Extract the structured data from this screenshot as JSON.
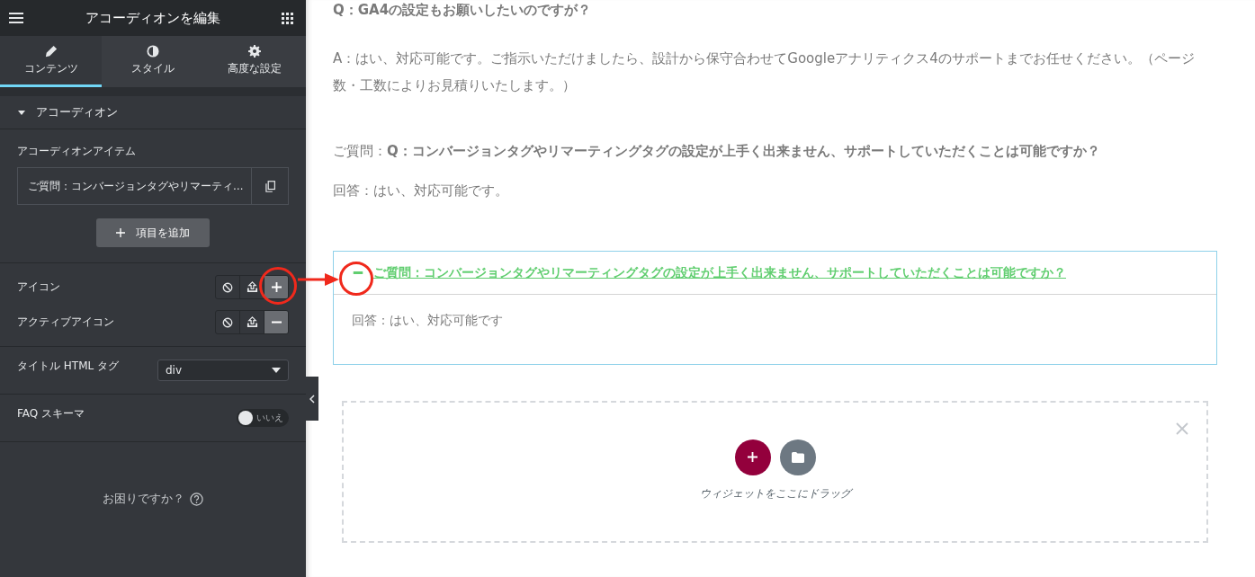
{
  "panel": {
    "title": "アコーディオンを編集",
    "tabs": [
      {
        "label": "コンテンツ",
        "selected": true
      },
      {
        "label": "スタイル",
        "selected": false
      },
      {
        "label": "高度な設定",
        "selected": false
      }
    ],
    "section": {
      "title": "アコーディオン",
      "expanded": true
    },
    "items_label": "アコーディオンアイテム",
    "items": [
      {
        "title": "ご質問：コンバージョンタグやリマーティ…"
      }
    ],
    "add_button": "項目を追加",
    "icon_controls": [
      {
        "label": "アイコン",
        "choices": [
          {
            "kind": "none",
            "selected": false
          },
          {
            "kind": "upload",
            "selected": false
          },
          {
            "kind": "plus",
            "selected": true
          }
        ]
      },
      {
        "label": "アクティブアイコン",
        "choices": [
          {
            "kind": "none",
            "selected": false
          },
          {
            "kind": "upload",
            "selected": false
          },
          {
            "kind": "minus",
            "selected": true
          }
        ]
      }
    ],
    "html_tag": {
      "label": "タイトル HTML タグ",
      "value": "div"
    },
    "faq_schema": {
      "label": "FAQ スキーマ",
      "on": false,
      "state_label": "いいえ"
    },
    "help": "お困りですか？"
  },
  "page": {
    "paragraphs": [
      {
        "kind": "heading",
        "text": "Q：GA4の設定もお願いしたいのですが？"
      },
      {
        "kind": "text",
        "text": "A：はい、対応可能です。ご指示いただけましたら、設計から保守合わせてGoogleアナリティクス4のサポートまでお任せください。（ページ数・工数によりお見積りいたします。）"
      },
      {
        "kind": "text",
        "text": "ご質問：**Q：コンバージョンタグやリマーティングタグの設定が上手く出来ません、サポートしていただくことは可能ですか？**"
      },
      {
        "kind": "text",
        "text": "回答：はい、対応可能です。"
      }
    ],
    "accordion": {
      "title": "ご質問：コンバージョンタグやリマーティングタグの設定が上手く出来ません、サポートしていただくことは可能ですか？",
      "expanded": true,
      "answer": "回答：はい、対応可能です"
    },
    "drop_zone": {
      "hint": "ウィジェットをここにドラッグ"
    }
  },
  "annotations": [
    {
      "kind": "circle-plus"
    },
    {
      "kind": "arrow"
    },
    {
      "kind": "circle-minus"
    }
  ]
}
